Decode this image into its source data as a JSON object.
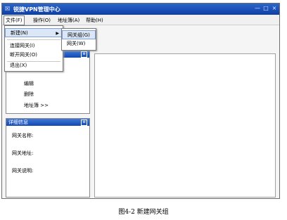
{
  "window": {
    "title": "锐捷VPN管理中心",
    "logo_glyph": "☒",
    "controls": [
      "—",
      "□",
      "×"
    ]
  },
  "menubar": {
    "items": [
      "文件(F)",
      "操作(O)",
      "地址簿(A)",
      "帮助(H)"
    ]
  },
  "file_menu": {
    "items": [
      "新建(N)",
      "连接网关(I)",
      "断开网关(O)",
      "退出(X)"
    ],
    "submenu_arrow": "▶"
  },
  "new_submenu": {
    "items": [
      "网关组(G)",
      "网关(W)"
    ]
  },
  "nav_panel": {
    "collapse_glyph": "⊗",
    "items": [
      "编辑",
      "删除",
      "地址簿 >>"
    ]
  },
  "detail_panel": {
    "title": "详细信息",
    "collapse_glyph": "⊗",
    "fields": [
      "网关名称:",
      "网关地址:",
      "网关说明:"
    ]
  },
  "caption": "图4-2  新建网关组",
  "colors": {
    "titlebar": "#1a4fb5",
    "highlight": "#dbe6f7"
  }
}
